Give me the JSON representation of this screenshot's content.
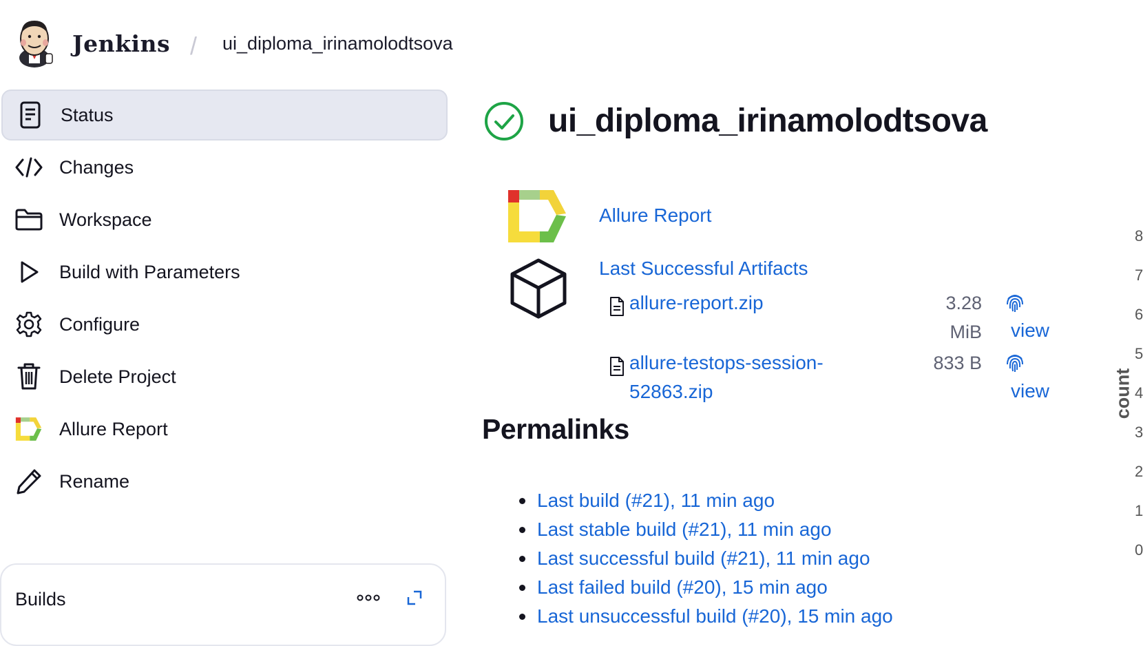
{
  "header": {
    "brand": "Jenkins",
    "breadcrumb_separator": "/",
    "breadcrumb_item": "ui_diploma_irinamolodtsova"
  },
  "sidebar": {
    "items": [
      {
        "label": "Status",
        "icon": "document-icon",
        "active": true
      },
      {
        "label": "Changes",
        "icon": "code-icon"
      },
      {
        "label": "Workspace",
        "icon": "folder-icon"
      },
      {
        "label": "Build with Parameters",
        "icon": "play-icon"
      },
      {
        "label": "Configure",
        "icon": "gear-icon"
      },
      {
        "label": "Delete Project",
        "icon": "trash-icon"
      },
      {
        "label": "Allure Report",
        "icon": "allure-icon"
      },
      {
        "label": "Rename",
        "icon": "pencil-icon"
      }
    ]
  },
  "builds": {
    "title": "Builds"
  },
  "main": {
    "title": "ui_diploma_irinamolodtsova",
    "status_icon": "success-check-icon",
    "status_color": "#1ea446",
    "allure_link": "Allure Report",
    "artifacts_title": "Last Successful Artifacts",
    "artifacts": [
      {
        "name_line1": "allure-report.zip",
        "name_line2": "",
        "size_line1": "3.28",
        "size_line2": "MiB",
        "view": "view"
      },
      {
        "name_line1": "allure-testops-session-",
        "name_line2": "52863.zip",
        "size_line1": "833 B",
        "size_line2": "",
        "view": "view"
      }
    ],
    "permalinks_title": "Permalinks",
    "permalinks": [
      "Last build (#21), 11 min ago",
      "Last stable build (#21), 11 min ago",
      "Last successful build (#21), 11 min ago",
      "Last failed build (#20), 15 min ago",
      "Last unsuccessful build (#20), 15 min ago"
    ]
  },
  "chart": {
    "ylabel": "count",
    "ticks": [
      "8",
      "7",
      "6",
      "5",
      "4",
      "3",
      "2",
      "1",
      "0"
    ]
  },
  "colors": {
    "link": "#1866d6",
    "active_bg": "#e6e8f1"
  }
}
